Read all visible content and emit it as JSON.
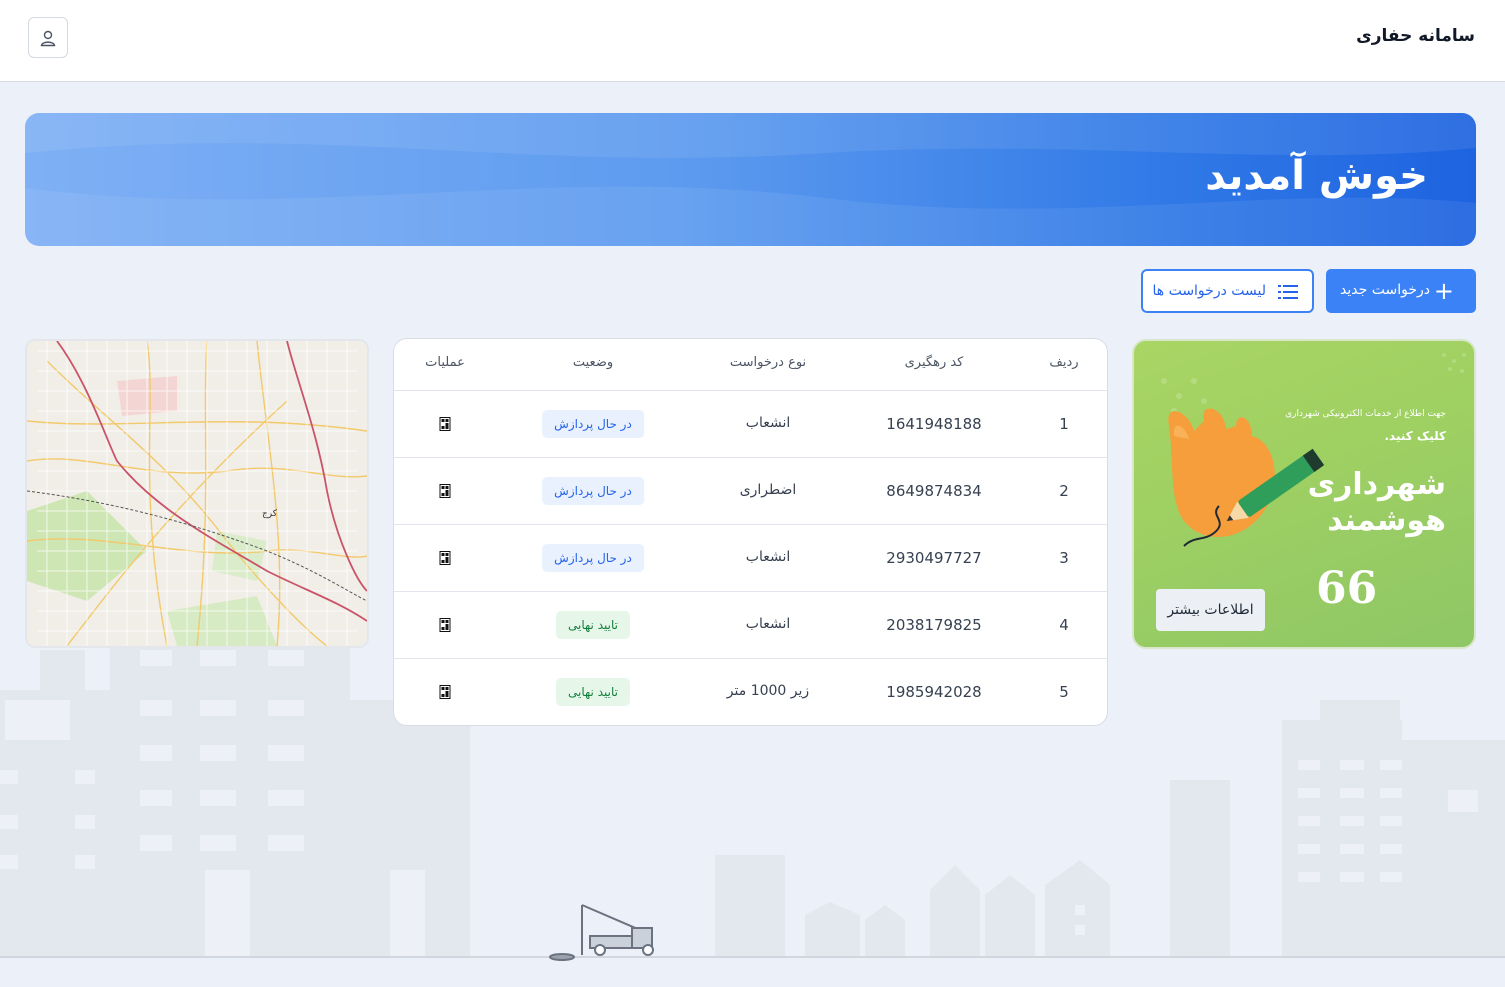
{
  "header": {
    "app_title": "سامانه حفاری",
    "user_icon": "user-icon"
  },
  "banner": {
    "title": "خوش آمدید"
  },
  "actions": {
    "new_request": "درخواست جدید",
    "request_list": "لیست درخواست ها"
  },
  "ad": {
    "small_text": "جهت اطلاع از خدمات الکترونیکی شهرداری",
    "click_text": "کلیک کنید.",
    "title": "شهرداری هوشمند",
    "quote": "66",
    "more_button": "اطلاعات بیشتر"
  },
  "table": {
    "columns": [
      "ردیف",
      "کد رهگیری",
      "نوع درخواست",
      "وضعیت",
      "عملیات"
    ],
    "rows": [
      {
        "index": "1",
        "code": "1641948188",
        "type": "انشعاب",
        "status": "در حال پردازش",
        "status_kind": "processing"
      },
      {
        "index": "2",
        "code": "8649874834",
        "type": "اضطراری",
        "status": "در حال پردازش",
        "status_kind": "processing"
      },
      {
        "index": "3",
        "code": "2930497727",
        "type": "انشعاب",
        "status": "در حال پردازش",
        "status_kind": "processing"
      },
      {
        "index": "4",
        "code": "2038179825",
        "type": "انشعاب",
        "status": "تایید نهایی",
        "status_kind": "approved"
      },
      {
        "index": "5",
        "code": "1985942028",
        "type": "زیر 1000 متر",
        "status": "تایید نهایی",
        "status_kind": "approved"
      }
    ]
  },
  "map": {
    "center_label": "کرج"
  },
  "colors": {
    "primary": "#3b82f6",
    "processing_bg": "#e8f1fd",
    "approved_bg": "#e6f7ea"
  }
}
